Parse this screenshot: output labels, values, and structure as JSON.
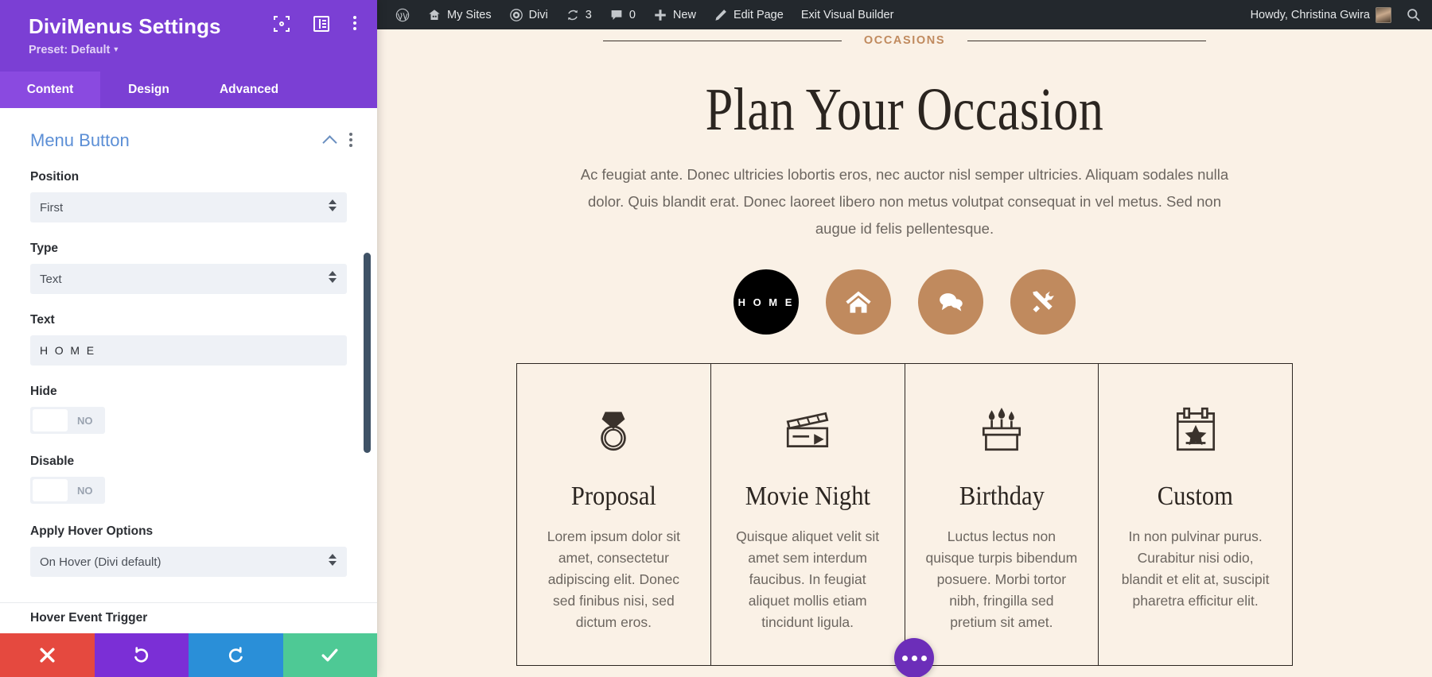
{
  "settings": {
    "title": "DiviMenus Settings",
    "preset_label": "Preset: Default",
    "header_icons": [
      {
        "name": "focus-target-icon"
      },
      {
        "name": "layout-panel-icon"
      },
      {
        "name": "kebab-menu-icon"
      }
    ],
    "tabs": [
      {
        "label": "Content",
        "active": true
      },
      {
        "label": "Design",
        "active": false
      },
      {
        "label": "Advanced",
        "active": false
      }
    ],
    "section": {
      "title": "Menu Button",
      "collapse_icon": "chevron-up-icon",
      "options_icon": "kebab-menu-icon"
    },
    "fields": {
      "position": {
        "label": "Position",
        "value": "First"
      },
      "type": {
        "label": "Type",
        "value": "Text"
      },
      "text": {
        "label": "Text",
        "value": "H O M E"
      },
      "hide": {
        "label": "Hide",
        "value": "NO"
      },
      "disable": {
        "label": "Disable",
        "value": "NO"
      },
      "hover": {
        "label": "Apply Hover Options",
        "value": "On Hover (Divi default)"
      },
      "partial_next": {
        "label": "Hover Event Trigger"
      }
    },
    "footer": {
      "cancel": "close-icon",
      "undo": "undo-icon",
      "redo": "redo-icon",
      "save": "check-icon"
    },
    "colors": {
      "header": "#7b3fd4",
      "tab_active": "#8a4ae0",
      "section_title": "#5c8fd6",
      "cancel": "#e5493f",
      "undo": "#7b2fd6",
      "redo": "#2a8fd8",
      "save": "#4ec995"
    }
  },
  "adminbar": {
    "items": [
      {
        "icon": "wordpress-logo-icon",
        "label": ""
      },
      {
        "icon": "site-house-icon",
        "label": "My Sites"
      },
      {
        "icon": "divi-gauge-icon",
        "label": "Divi"
      },
      {
        "icon": "updates-refresh-icon",
        "label": "3"
      },
      {
        "icon": "comment-bubble-icon",
        "label": "0"
      },
      {
        "icon": "plus-icon",
        "label": "New"
      },
      {
        "icon": "pencil-icon",
        "label": "Edit Page"
      },
      {
        "icon": "",
        "label": "Exit Visual Builder"
      }
    ],
    "howdy": "Howdy, Christina Gwira",
    "search_icon": "search-icon"
  },
  "page": {
    "eyebrow": "OCCASIONS",
    "heading": "Plan Your Occasion",
    "subtext": "Ac feugiat ante. Donec ultricies lobortis eros, nec auctor nisl semper ultricies. Aliquam sodales nulla dolor. Quis blandit erat. Donec laoreet libero non metus volutpat consequat in vel metus. Sed non augue id felis pellentesque.",
    "menu_buttons": [
      {
        "label": "H O M E",
        "icon": "",
        "style": "dark"
      },
      {
        "label": "",
        "icon": "home-icon",
        "style": "tan"
      },
      {
        "label": "",
        "icon": "chat-bubbles-icon",
        "style": "tan"
      },
      {
        "label": "",
        "icon": "tools-icon",
        "style": "tan"
      }
    ],
    "cards": [
      {
        "icon": "ring-diamond-icon",
        "title": "Proposal",
        "text": "Lorem ipsum dolor sit amet, consectetur adipiscing elit. Donec sed finibus nisi, sed dictum eros."
      },
      {
        "icon": "clapperboard-icon",
        "title": "Movie Night",
        "text": "Quisque aliquet velit sit amet sem interdum faucibus. In feugiat aliquet mollis etiam tincidunt ligula."
      },
      {
        "icon": "birthday-cake-icon",
        "title": "Birthday",
        "text": "Luctus lectus non quisque turpis bibendum posuere. Morbi tortor nibh, fringilla sed pretium sit amet."
      },
      {
        "icon": "calendar-star-icon",
        "title": "Custom",
        "text": "In non pulvinar purus. Curabitur nisi odio, blandit et elit at, suscipit pharetra efficitur elit."
      }
    ],
    "fab_icon": "ellipsis-icon",
    "colors": {
      "background": "#faf1e6",
      "accent": "#c08a5e",
      "ink": "#2b2520",
      "body_text": "#6c6660"
    }
  }
}
